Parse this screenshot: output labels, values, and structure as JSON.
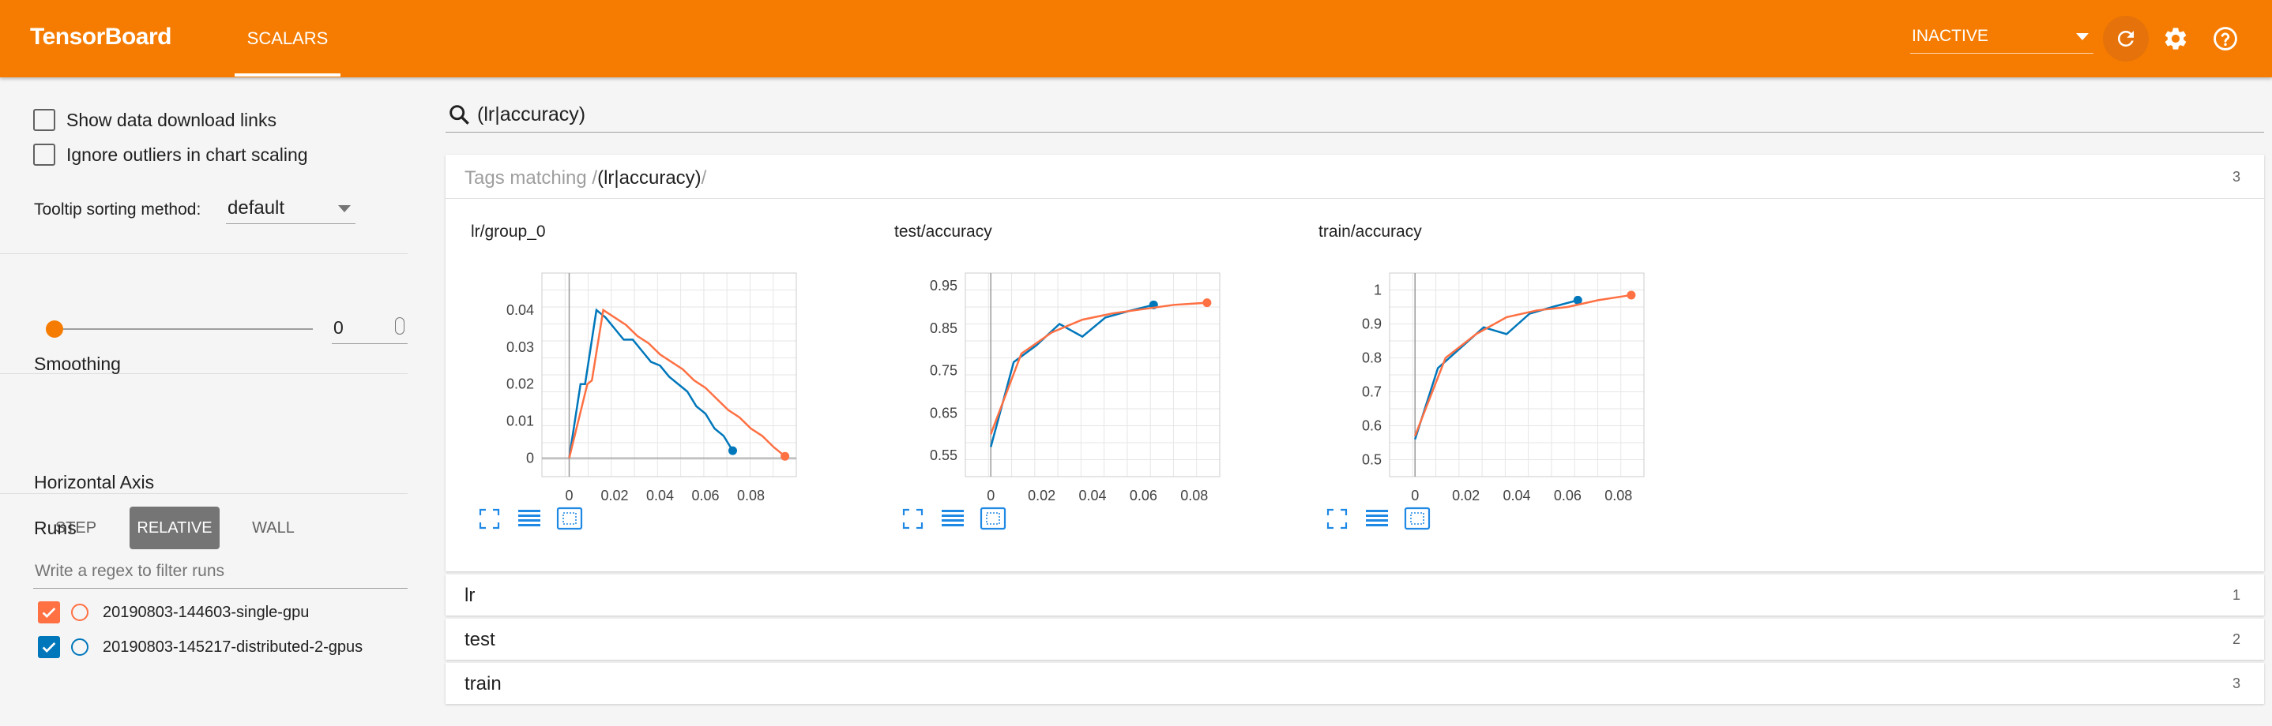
{
  "header": {
    "brand": "TensorBoard",
    "tab": "SCALARS",
    "status": "INACTIVE",
    "bg_color": "#f57c00"
  },
  "sidebar": {
    "show_download": "Show data download links",
    "ignore_outliers": "Ignore outliers in chart scaling",
    "tooltip_label": "Tooltip sorting method:",
    "tooltip_value": "default",
    "smoothing_label": "Smoothing",
    "smoothing_value": "0",
    "smoothing_fraction": 0,
    "haxis_label": "Horizontal Axis",
    "haxis_options": [
      "STEP",
      "RELATIVE",
      "WALL"
    ],
    "haxis_selected": "RELATIVE",
    "runs_label": "Runs",
    "runs_filter_placeholder": "Write a regex to filter runs",
    "runs": [
      {
        "name": "20190803-144603-single-gpu",
        "color": "#ff7043",
        "checked": true
      },
      {
        "name": "20190803-145217-distributed-2-gpus",
        "color": "#0077bb",
        "checked": true
      }
    ]
  },
  "search": {
    "value": "(lr|accuracy)"
  },
  "tags_panel": {
    "prefix": "Tags matching /",
    "pattern": "(lr|accuracy)",
    "suffix": "/",
    "count": "3"
  },
  "groups": [
    {
      "label": "lr",
      "count": "1"
    },
    {
      "label": "test",
      "count": "2"
    },
    {
      "label": "train",
      "count": "3"
    }
  ],
  "chart_data": [
    {
      "type": "line",
      "title": "lr/group_0",
      "xlim": [
        -0.012,
        0.1
      ],
      "ylim": [
        -0.005,
        0.05
      ],
      "xticks": [
        "0",
        "0.02",
        "0.04",
        "0.06",
        "0.08"
      ],
      "xtick_values": [
        0,
        0.02,
        0.04,
        0.06,
        0.08
      ],
      "yticks": [
        "0",
        "0.01",
        "0.02",
        "0.03",
        "0.04"
      ],
      "ytick_values": [
        0,
        0.01,
        0.02,
        0.03,
        0.04
      ],
      "series": [
        {
          "name": "20190803-145217-distributed-2-gpus",
          "color": "#0077bb",
          "x": [
            0,
            0.005,
            0.007,
            0.012,
            0.016,
            0.02,
            0.024,
            0.028,
            0.032,
            0.036,
            0.04,
            0.044,
            0.048,
            0.052,
            0.056,
            0.06,
            0.064,
            0.068,
            0.072
          ],
          "y": [
            0,
            0.02,
            0.02,
            0.04,
            0.038,
            0.035,
            0.032,
            0.032,
            0.029,
            0.026,
            0.025,
            0.022,
            0.02,
            0.018,
            0.014,
            0.012,
            0.008,
            0.006,
            0.002
          ]
        },
        {
          "name": "20190803-144603-single-gpu",
          "color": "#ff7043",
          "x": [
            0,
            0.008,
            0.01,
            0.015,
            0.02,
            0.025,
            0.03,
            0.035,
            0.04,
            0.045,
            0.05,
            0.055,
            0.06,
            0.065,
            0.07,
            0.075,
            0.08,
            0.085,
            0.09,
            0.095
          ],
          "y": [
            0,
            0.02,
            0.021,
            0.04,
            0.038,
            0.036,
            0.033,
            0.031,
            0.028,
            0.026,
            0.024,
            0.021,
            0.019,
            0.016,
            0.013,
            0.011,
            0.008,
            0.006,
            0.003,
            0.0005
          ]
        }
      ]
    },
    {
      "type": "line",
      "title": "test/accuracy",
      "xlim": [
        -0.01,
        0.09
      ],
      "ylim": [
        0.5,
        0.98
      ],
      "xticks": [
        "0",
        "0.02",
        "0.04",
        "0.06",
        "0.08"
      ],
      "xtick_values": [
        0,
        0.02,
        0.04,
        0.06,
        0.08
      ],
      "yticks": [
        "0.55",
        "0.65",
        "0.75",
        "0.85",
        "0.95"
      ],
      "ytick_values": [
        0.55,
        0.65,
        0.75,
        0.85,
        0.95
      ],
      "series": [
        {
          "name": "20190803-145217-distributed-2-gpus",
          "color": "#0077bb",
          "x": [
            0,
            0.009,
            0.018,
            0.027,
            0.036,
            0.045,
            0.054,
            0.064
          ],
          "y": [
            0.57,
            0.77,
            0.81,
            0.86,
            0.83,
            0.875,
            0.89,
            0.905
          ]
        },
        {
          "name": "20190803-144603-single-gpu",
          "color": "#ff7043",
          "x": [
            0,
            0.012,
            0.024,
            0.036,
            0.048,
            0.06,
            0.072,
            0.085
          ],
          "y": [
            0.6,
            0.79,
            0.84,
            0.87,
            0.885,
            0.895,
            0.905,
            0.91
          ]
        }
      ]
    },
    {
      "type": "line",
      "title": "train/accuracy",
      "xlim": [
        -0.01,
        0.09
      ],
      "ylim": [
        0.45,
        1.05
      ],
      "xticks": [
        "0",
        "0.02",
        "0.04",
        "0.06",
        "0.08"
      ],
      "xtick_values": [
        0,
        0.02,
        0.04,
        0.06,
        0.08
      ],
      "yticks": [
        "0.5",
        "0.6",
        "0.7",
        "0.8",
        "0.9",
        "1"
      ],
      "ytick_values": [
        0.5,
        0.6,
        0.7,
        0.8,
        0.9,
        1.0
      ],
      "series": [
        {
          "name": "20190803-145217-distributed-2-gpus",
          "color": "#0077bb",
          "x": [
            0,
            0.009,
            0.018,
            0.027,
            0.036,
            0.045,
            0.054,
            0.064
          ],
          "y": [
            0.56,
            0.77,
            0.83,
            0.89,
            0.87,
            0.93,
            0.95,
            0.97
          ]
        },
        {
          "name": "20190803-144603-single-gpu",
          "color": "#ff7043",
          "x": [
            0,
            0.012,
            0.024,
            0.036,
            0.048,
            0.06,
            0.072,
            0.085
          ],
          "y": [
            0.57,
            0.8,
            0.87,
            0.92,
            0.94,
            0.95,
            0.97,
            0.985
          ]
        }
      ]
    }
  ]
}
